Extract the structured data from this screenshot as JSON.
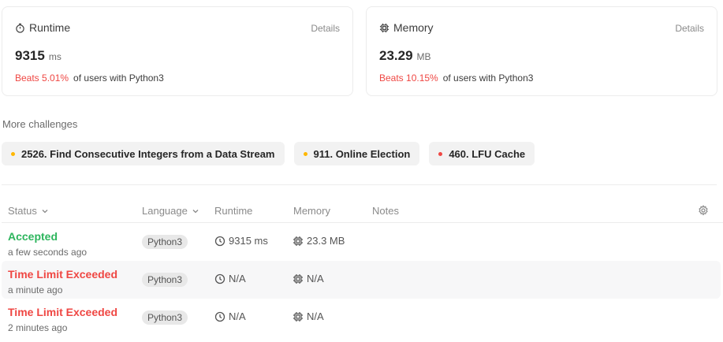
{
  "cards": {
    "runtime": {
      "title": "Runtime",
      "details": "Details",
      "value": "9315",
      "unit": "ms",
      "beats": "Beats 5.01%",
      "suffix": "of users with Python3",
      "icon": "stopwatch-icon"
    },
    "memory": {
      "title": "Memory",
      "details": "Details",
      "value": "23.29",
      "unit": "MB",
      "beats": "Beats 10.15%",
      "suffix": "of users with Python3",
      "icon": "chip-icon"
    }
  },
  "more_challenges": {
    "title": "More challenges",
    "items": [
      {
        "label": "2526. Find Consecutive Integers from a Data Stream",
        "color": "#ffb700"
      },
      {
        "label": "911. Online Election",
        "color": "#ffb700"
      },
      {
        "label": "460. LFU Cache",
        "color": "#ef4743"
      }
    ]
  },
  "table": {
    "headers": {
      "status": "Status",
      "language": "Language",
      "runtime": "Runtime",
      "memory": "Memory",
      "notes": "Notes"
    },
    "rows": [
      {
        "status": "Accepted",
        "time": "a few seconds ago",
        "language": "Python3",
        "runtime": "9315 ms",
        "memory": "23.3 MB"
      },
      {
        "status": "Time Limit Exceeded",
        "time": "a minute ago",
        "language": "Python3",
        "runtime": "N/A",
        "memory": "N/A"
      },
      {
        "status": "Time Limit Exceeded",
        "time": "2 minutes ago",
        "language": "Python3",
        "runtime": "N/A",
        "memory": "N/A"
      }
    ]
  },
  "colors": {
    "accepted": "#2db55d",
    "error": "#ef4743",
    "medium": "#ffb700"
  }
}
